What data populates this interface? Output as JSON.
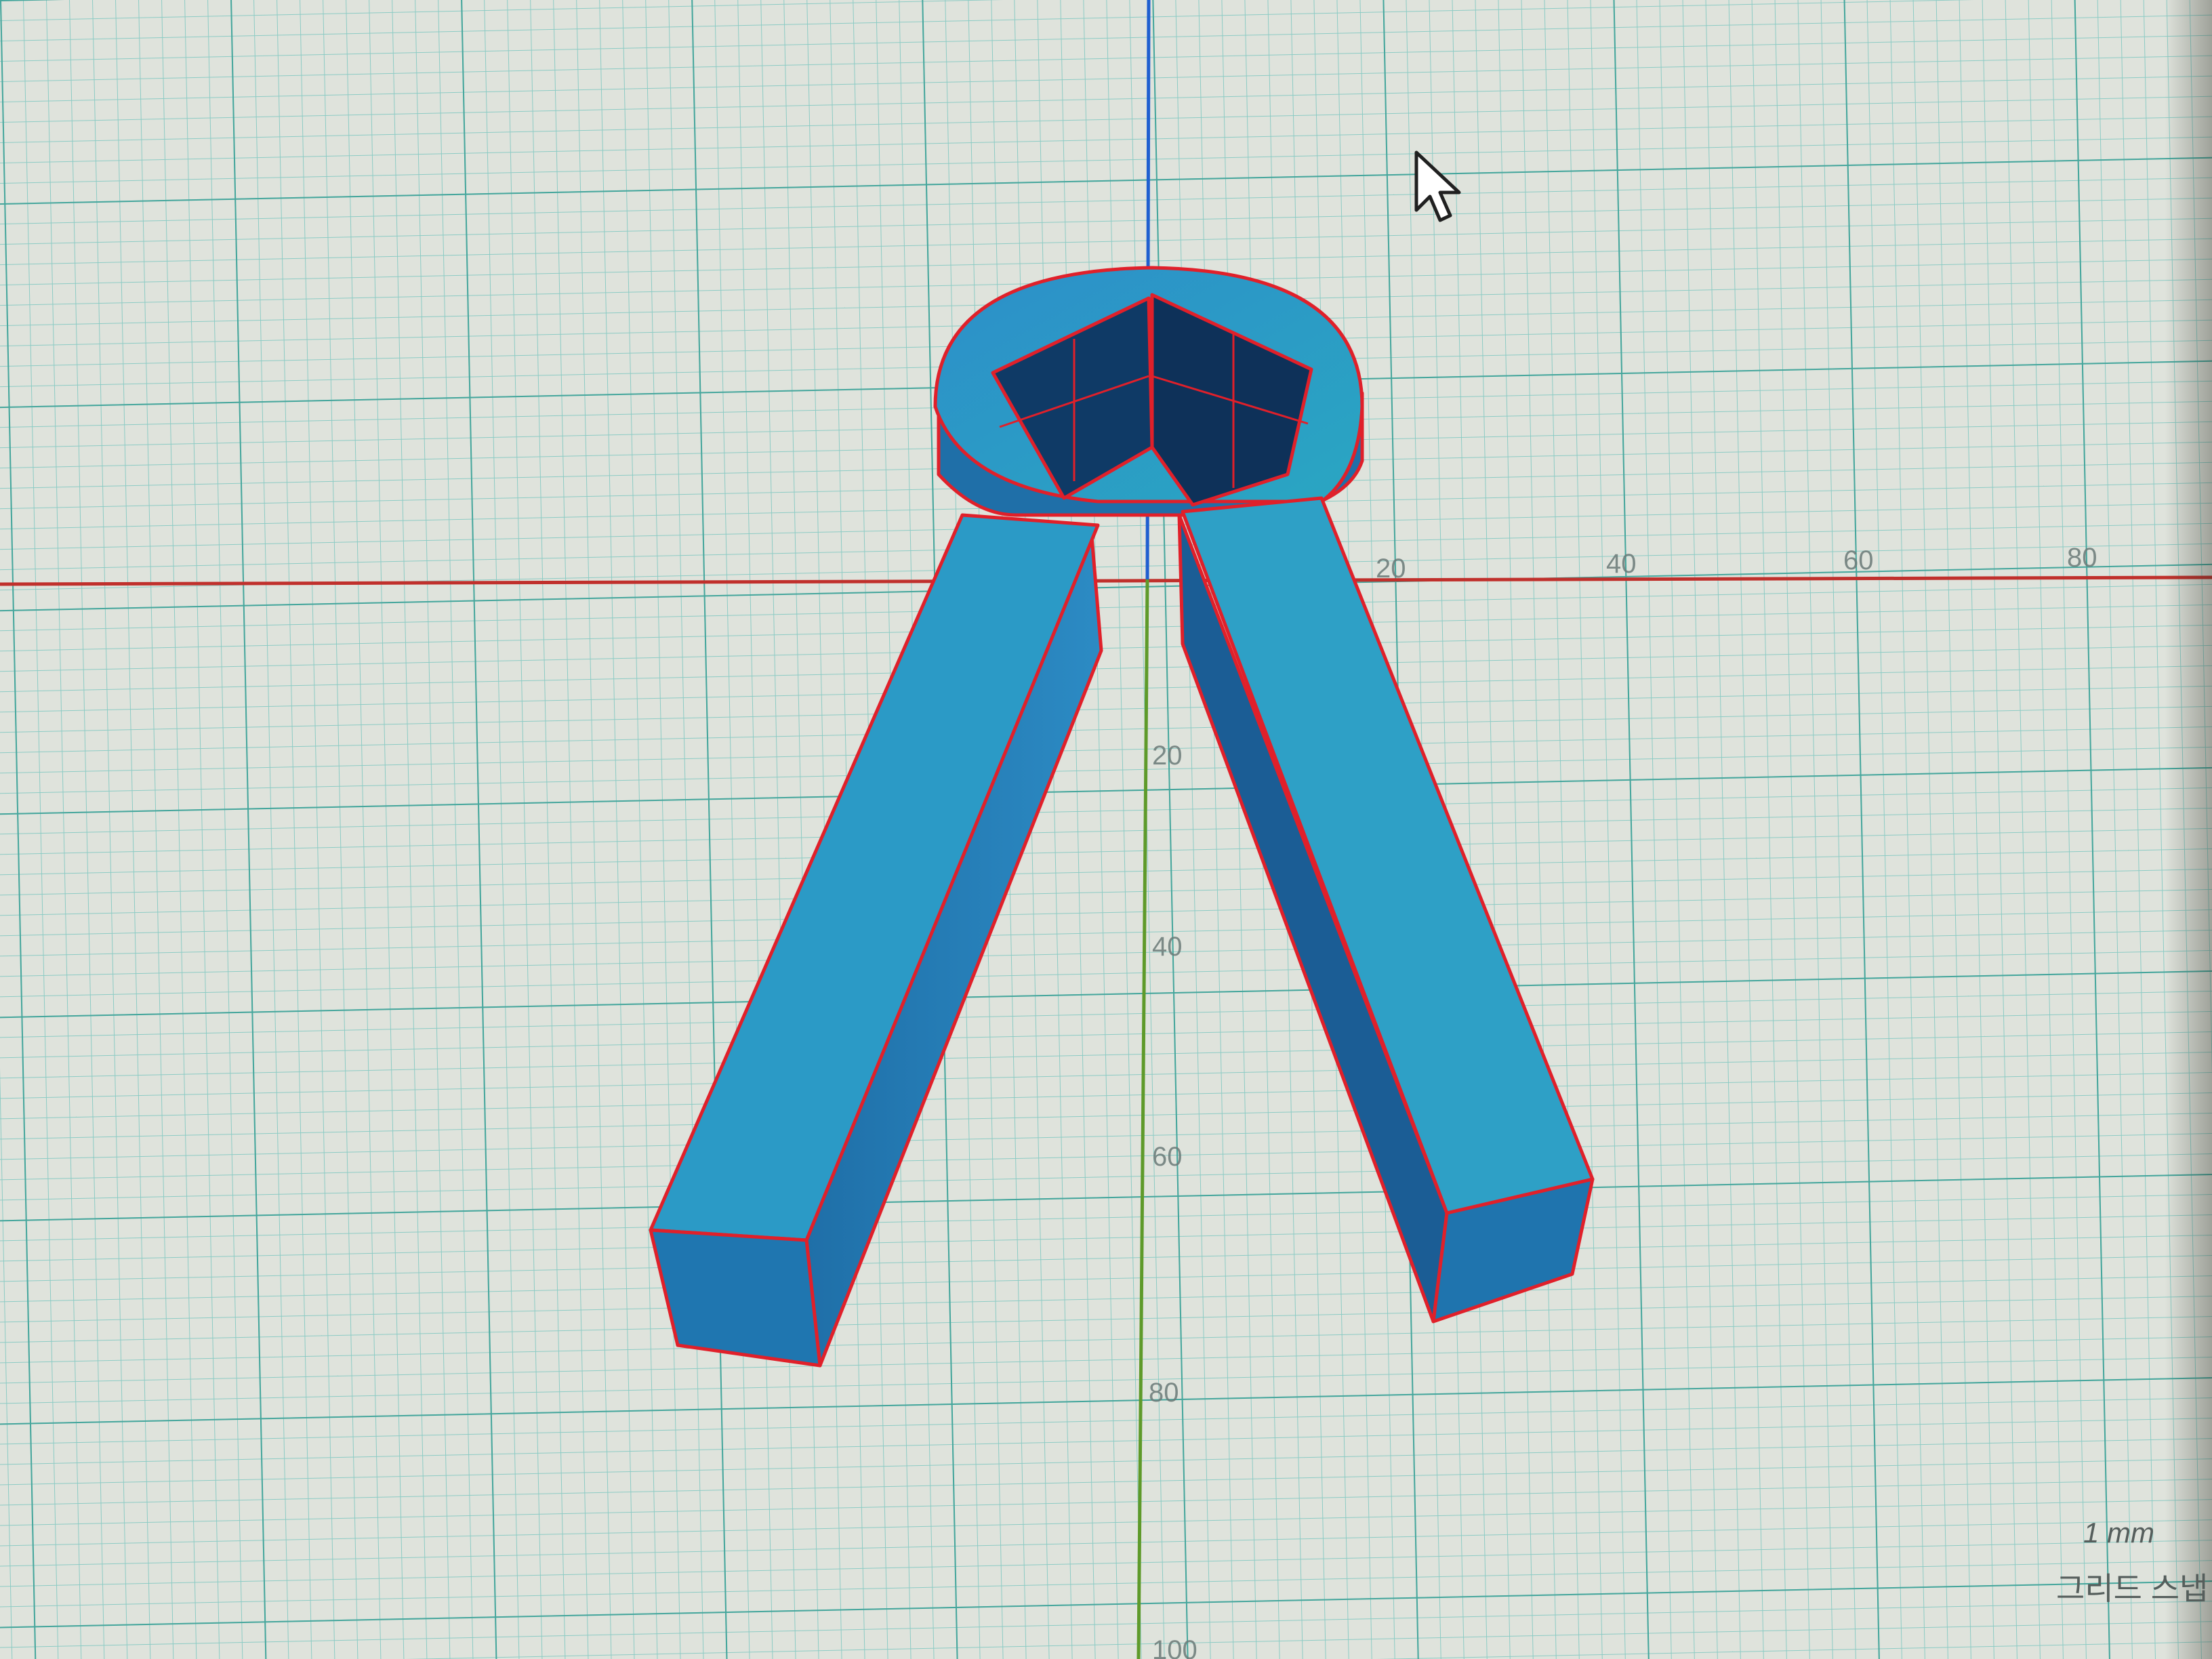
{
  "x_axis_ticks": [
    "20",
    "40",
    "60",
    "80"
  ],
  "y_axis_ticks": [
    "20",
    "40",
    "60",
    "80",
    "100"
  ],
  "grid_snap": {
    "value": "1 mm",
    "label": "그리드 스냅"
  },
  "colors": {
    "background": "#dfe3dc",
    "grid_line": "#5fb8b0",
    "x_axis": "#c0302c",
    "y_axis_top": "#1f5fd0",
    "y_axis_bottom": "#5e9a2a",
    "model_fill": "#2a9dd0",
    "model_edge": "#e0202a"
  },
  "icons": {
    "cursor": "mouse-pointer-icon"
  }
}
